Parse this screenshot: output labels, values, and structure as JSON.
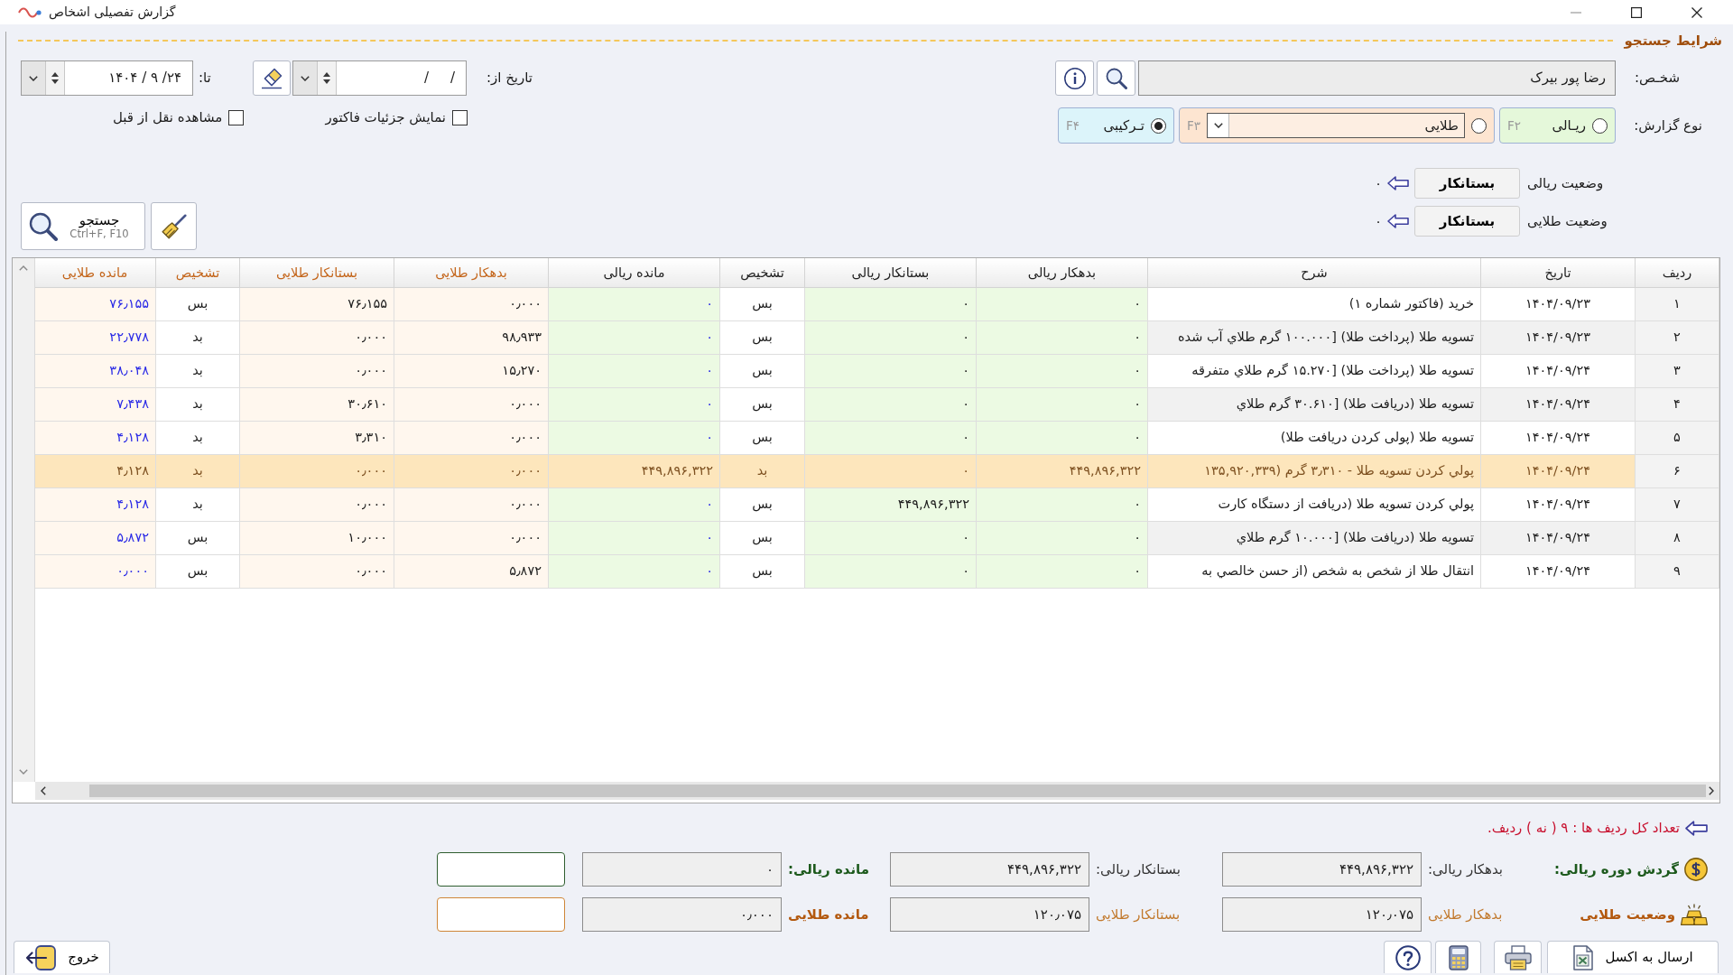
{
  "window": {
    "title": "گزارش تفصیلی اشخاص"
  },
  "search_section": {
    "title": "شرایط جستجو"
  },
  "person": {
    "label": "شخـص:",
    "value": "رضا پور بیرک"
  },
  "report_type": {
    "label": "نوع گزارش:",
    "options": [
      {
        "kind": "radio",
        "label": "ریـالی",
        "shortcut": "F۲",
        "color": "#e5f8da",
        "selected": false
      },
      {
        "kind": "combo",
        "value": "طلایی",
        "shortcut": "F۳",
        "color": "#fde5d1",
        "selected": false
      },
      {
        "kind": "radio",
        "label": "تـرکیبی",
        "shortcut": "F۴",
        "color": "#dcf4fa",
        "selected": true
      }
    ]
  },
  "statuses": [
    {
      "label": "وضعیت ریالی",
      "value": "بستانکار",
      "amount": "۰"
    },
    {
      "label": "وضعیت طلایی",
      "value": "بستانکار",
      "amount": "۰"
    }
  ],
  "date_from": {
    "label": "تاریخ از:",
    "value": "/     /"
  },
  "date_to": {
    "label": "تا:",
    "value": "۱۴۰۴ / ۹ /۲۴"
  },
  "options": [
    {
      "label": "نمایش جزئیات فاکتور",
      "checked": false
    },
    {
      "label": "مشاهده نقل از قبل",
      "checked": false
    }
  ],
  "search_button": {
    "label": "جستجو",
    "shortcut": "Ctrl+F, F10"
  },
  "table": {
    "columns": [
      {
        "label": "ردیف",
        "kind": "index"
      },
      {
        "label": "تاریخ",
        "kind": "date"
      },
      {
        "label": "شرح",
        "kind": "text"
      },
      {
        "label": "بدهکار ریالی",
        "kind": "rial"
      },
      {
        "label": "بستانکار ریالی",
        "kind": "rial"
      },
      {
        "label": "تشخیص",
        "kind": "rial_status"
      },
      {
        "label": "مانده ریالی",
        "kind": "rial_balance"
      },
      {
        "label": "بدهکار طلایی",
        "kind": "gold"
      },
      {
        "label": "بستانکار طلایی",
        "kind": "gold"
      },
      {
        "label": "تشخیص",
        "kind": "gold_status"
      },
      {
        "label": "مانده طلایی",
        "kind": "gold_balance"
      }
    ],
    "rows": [
      {
        "selected": false,
        "cells": [
          "۱",
          "۱۴۰۴/۰۹/۲۳",
          "خرید (فاکتور شماره ۱)",
          "۰",
          "۰",
          "بس",
          "۰",
          "۰٫۰۰۰",
          "۷۶٫۱۵۵",
          "بس",
          "۷۶٫۱۵۵"
        ]
      },
      {
        "selected": false,
        "cells": [
          "۲",
          "۱۴۰۴/۰۹/۲۳",
          "تسویه طلا (پرداخت طلا) [۱۰۰.۰۰۰ گرم طلاي آب شده",
          "۰",
          "۰",
          "بس",
          "۰",
          "۹۸٫۹۳۳",
          "۰٫۰۰۰",
          "بد",
          "۲۲٫۷۷۸"
        ]
      },
      {
        "selected": false,
        "cells": [
          "۳",
          "۱۴۰۴/۰۹/۲۴",
          "تسویه طلا (پرداخت طلا) [۱۵.۲۷۰ گرم طلاي متفرقه",
          "۰",
          "۰",
          "بس",
          "۰",
          "۱۵٫۲۷۰",
          "۰٫۰۰۰",
          "بد",
          "۳۸٫۰۴۸"
        ]
      },
      {
        "selected": false,
        "cells": [
          "۴",
          "۱۴۰۴/۰۹/۲۴",
          "تسویه طلا (دریافت طلا) [۳۰.۶۱۰ گرم طلاي",
          "۰",
          "۰",
          "بس",
          "۰",
          "۰٫۰۰۰",
          "۳۰٫۶۱۰",
          "بد",
          "۷٫۴۳۸"
        ]
      },
      {
        "selected": false,
        "cells": [
          "۵",
          "۱۴۰۴/۰۹/۲۴",
          "تسویه طلا (پولی کردن دریافت طلا)",
          "۰",
          "۰",
          "بس",
          "۰",
          "۰٫۰۰۰",
          "۳٫۳۱۰",
          "بد",
          "۴٫۱۲۸"
        ]
      },
      {
        "selected": true,
        "cells": [
          "۶",
          "۱۴۰۴/۰۹/۲۴",
          "پولي کردن تسویه طلا - ۳٫۳۱۰ گرم (۱۳۵,۹۲۰,۳۳۹",
          "۴۴۹,۸۹۶,۳۲۲",
          "۰",
          "بد",
          "۴۴۹,۸۹۶,۳۲۲",
          "۰٫۰۰۰",
          "۰٫۰۰۰",
          "بد",
          "۴٫۱۲۸"
        ]
      },
      {
        "selected": false,
        "cells": [
          "۷",
          "۱۴۰۴/۰۹/۲۴",
          "پولي کردن تسویه طلا (دریافت از دستگاه کارت",
          "۰",
          "۴۴۹,۸۹۶,۳۲۲",
          "بس",
          "۰",
          "۰٫۰۰۰",
          "۰٫۰۰۰",
          "بد",
          "۴٫۱۲۸"
        ]
      },
      {
        "selected": false,
        "cells": [
          "۸",
          "۱۴۰۴/۰۹/۲۴",
          "تسویه طلا (دریافت طلا) [۱۰.۰۰۰ گرم طلاي",
          "۰",
          "۰",
          "بس",
          "۰",
          "۰٫۰۰۰",
          "۱۰٫۰۰۰",
          "بس",
          "۵٫۸۷۲"
        ]
      },
      {
        "selected": false,
        "cells": [
          "۹",
          "۱۴۰۴/۰۹/۲۴",
          "انتقال طلا از شخص به شخص (از حسن خالصي به",
          "۰",
          "۰",
          "بس",
          "۰",
          "۵٫۸۷۲",
          "۰٫۰۰۰",
          "بس",
          "۰٫۰۰۰"
        ]
      }
    ]
  },
  "row_count": "تعداد کل ردیف ها : ۹ ( نه ) ردیف.",
  "totals": [
    {
      "kind": "rial",
      "title": "گردش دوره ریالی:",
      "debit_label": "بدهکار ریالی:",
      "debit": "۴۴۹,۸۹۶,۳۲۲",
      "credit_label": "بستانکار ریالی:",
      "credit": "۴۴۹,۸۹۶,۳۲۲",
      "balance_label": "مانده ریالی:",
      "balance": "۰"
    },
    {
      "kind": "gold",
      "title": "وضعیت طلایی",
      "debit_label": "بدهکار طلایی",
      "debit": "۱۲۰٫۰۷۵",
      "credit_label": "بستانکار طلایی",
      "credit": "۱۲۰٫۰۷۵",
      "balance_label": "مانده طلایی",
      "balance": "۰٫۰۰۰"
    }
  ],
  "footer_buttons": [
    {
      "kind": "excel",
      "label": "ارسال به اکسل"
    },
    {
      "kind": "print"
    },
    {
      "kind": "calculator"
    },
    {
      "kind": "help"
    },
    {
      "kind": "exit",
      "label": "خروج"
    }
  ]
}
